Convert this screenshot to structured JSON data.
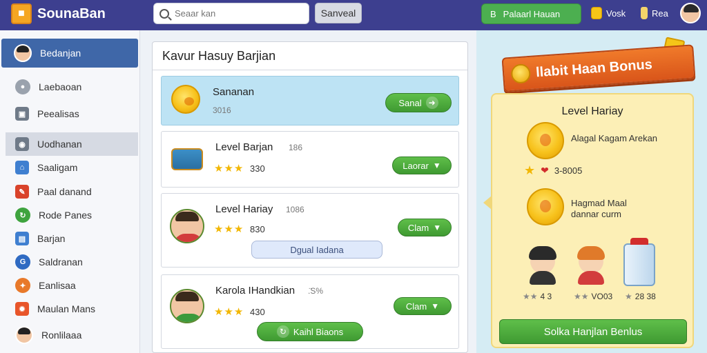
{
  "header": {
    "app_name": "SounaBan",
    "search_placeholder": "Seaar kan",
    "search_button": "Sanveal",
    "green_button": "Palaarl Hauan",
    "green_button_icon_letter": "B",
    "coins_label": "Vosk",
    "drink_label": "Rea"
  },
  "sidebar": {
    "items": [
      {
        "label": "Bedanjan",
        "icon": "avatar",
        "state": "active"
      },
      {
        "label": "Laebaoan",
        "icon": "person-icon"
      },
      {
        "label": "Peealisas",
        "icon": "box-icon"
      },
      {
        "label": "Uodhanan",
        "icon": "camera-icon",
        "state": "selected"
      },
      {
        "label": "Saaligam",
        "icon": "house-icon",
        "color": "#3f7fd0"
      },
      {
        "label": "Paal danand",
        "icon": "pencil-icon",
        "color": "#d9432b"
      },
      {
        "label": "Rode Panes",
        "icon": "circle-arrow-icon",
        "color": "#3ea33e"
      },
      {
        "label": "Barjan",
        "icon": "chart-icon",
        "color": "#3f7fd0"
      },
      {
        "label": "Saldranan",
        "icon": "g-icon",
        "color": "#2f6ac2"
      },
      {
        "label": "Eanlisaa",
        "icon": "wand-icon",
        "color": "#e8792a"
      },
      {
        "label": "Maulan Mans",
        "icon": "fire-icon",
        "color": "#e8552a"
      },
      {
        "label": "Ronlilaaa",
        "icon": "avatar"
      }
    ]
  },
  "main": {
    "title": "Kavur Hasuy Barjian",
    "cards": [
      {
        "title": "Sananan",
        "sub": "3016",
        "icon": "coin-icon",
        "button": "Sanal",
        "highlight": true
      },
      {
        "title": "Level Barjan",
        "sub": "186",
        "stars": "★★★",
        "stars_value": "330",
        "icon": "chest-icon",
        "button": "Laorar"
      },
      {
        "title": "Level Hariay",
        "sub": "1086",
        "stars": "★★★",
        "stars_value": "830",
        "icon": "person-icon",
        "button": "Clam",
        "secondary_button": "Dgual Iadana"
      },
      {
        "title": "Karola IHandkian",
        "sub": ".̈S%",
        "stars": "★★★",
        "stars_value": "430",
        "icon": "person-icon",
        "button": "Clam",
        "secondary_button": "Kaihl Biaons"
      }
    ]
  },
  "bonus": {
    "ribbon": "llabit Haan Bonus",
    "title": "Level Hariay",
    "reward1": "Alagal Kagam Arekan",
    "reward_row_value": "3-8005",
    "reward2_line1": "Hagmad Maal",
    "reward2_line2": "dannar curm",
    "characters": [
      {
        "caption": "4 3",
        "type": "boy"
      },
      {
        "caption": "VO03",
        "type": "girl"
      },
      {
        "caption": "28 38",
        "type": "can"
      }
    ],
    "claim_button": "Solka Hanjlan Benlus"
  }
}
